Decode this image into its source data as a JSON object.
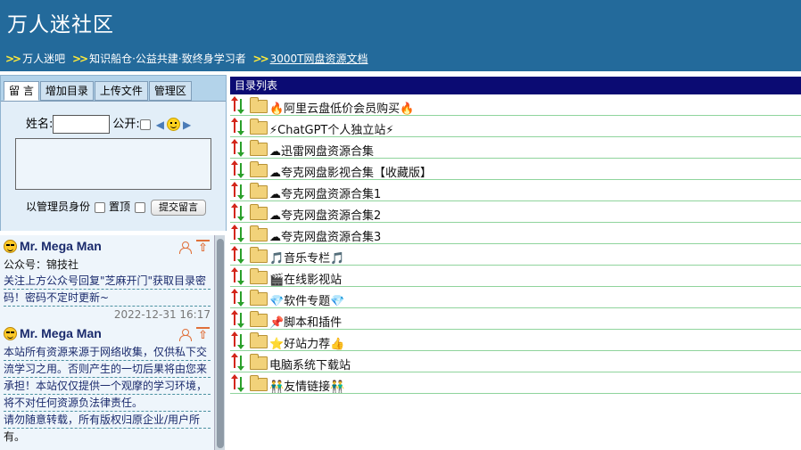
{
  "header": {
    "title": "万人迷社区",
    "breadcrumb": [
      "万人迷吧",
      "知识船仓·公益共建·致终身学习者",
      "3000T网盘资源文档"
    ],
    "sep": ">>"
  },
  "form": {
    "tabs": [
      "留 言",
      "增加目录",
      "上传文件",
      "管理区"
    ],
    "name_label": "姓名:",
    "public_label": "公开:",
    "admin_label": "以管理员身份",
    "pin_label": "置顶",
    "submit_label": "提交留言"
  },
  "comments": [
    {
      "name": "Mr. Mega Man",
      "lines": [
        "公众号：锦技社",
        "关注上方公众号回复\"芝麻开门\"获取目录密",
        "码！密码不定时更新~"
      ],
      "date": "2022-12-31 16:17"
    },
    {
      "name": "Mr. Mega Man",
      "lines": [
        "本站所有资源来源于网络收集，仅供私下交",
        "流学习之用。否则产生的一切后果将由您来",
        "承担！本站仅仅提供一个观摩的学习环境，",
        "将不对任何资源负法律责任。",
        "请勿随意转载，所有版权归原企业/用户所",
        "有。"
      ]
    }
  ],
  "directory": {
    "header": "目录列表",
    "items": [
      "🔥阿里云盘低价会员购买🔥",
      "⚡ChatGPT个人独立站⚡",
      "☁迅雷网盘资源合集",
      "☁夸克网盘影视合集【收藏版】",
      "☁夸克网盘资源合集1",
      "☁夸克网盘资源合集2",
      "☁夸克网盘资源合集3",
      "🎵音乐专栏🎵",
      "🎬在线影视站",
      "💎软件专题💎",
      "📌脚本和插件",
      "⭐好站力荐👍",
      "电脑系统下载站",
      "👬友情链接👬"
    ]
  }
}
